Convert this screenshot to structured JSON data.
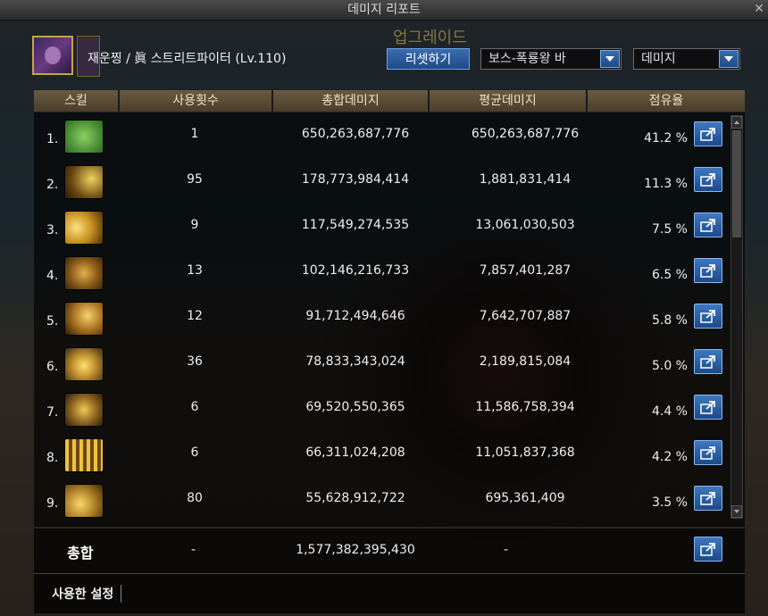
{
  "window": {
    "title": "데미지 리포트",
    "close_glyph": "✕"
  },
  "character": {
    "name": "재운찡 / 眞 스트리트파이터 (Lv.110)"
  },
  "controls": {
    "reset_label": "리셋하기",
    "boss_select_value": "보스-폭룡왕 바",
    "metric_select_value": "데미지"
  },
  "background_text": {
    "upgrade": "업그레이드"
  },
  "table": {
    "headers": [
      "스킬",
      "사용횟수",
      "총합데미지",
      "평균데미지",
      "점유율"
    ],
    "rows": [
      {
        "rank": "1.",
        "icon": "skill-icon-1",
        "uses": "1",
        "total": "650,263,687,776",
        "avg": "650,263,687,776",
        "pct": "41.2 %"
      },
      {
        "rank": "2.",
        "icon": "skill-icon-2",
        "uses": "95",
        "total": "178,773,984,414",
        "avg": "1,881,831,414",
        "pct": "11.3 %"
      },
      {
        "rank": "3.",
        "icon": "skill-icon-3",
        "uses": "9",
        "total": "117,549,274,535",
        "avg": "13,061,030,503",
        "pct": "7.5 %"
      },
      {
        "rank": "4.",
        "icon": "skill-icon-4",
        "uses": "13",
        "total": "102,146,216,733",
        "avg": "7,857,401,287",
        "pct": "6.5 %"
      },
      {
        "rank": "5.",
        "icon": "skill-icon-5",
        "uses": "12",
        "total": "91,712,494,646",
        "avg": "7,642,707,887",
        "pct": "5.8 %"
      },
      {
        "rank": "6.",
        "icon": "skill-icon-6",
        "uses": "36",
        "total": "78,833,343,024",
        "avg": "2,189,815,084",
        "pct": "5.0 %"
      },
      {
        "rank": "7.",
        "icon": "skill-icon-7",
        "uses": "6",
        "total": "69,520,550,365",
        "avg": "11,586,758,394",
        "pct": "4.4 %"
      },
      {
        "rank": "8.",
        "icon": "skill-icon-8",
        "uses": "6",
        "total": "66,311,024,208",
        "avg": "11,051,837,368",
        "pct": "4.2 %"
      },
      {
        "rank": "9.",
        "icon": "skill-icon-9",
        "uses": "80",
        "total": "55,628,912,722",
        "avg": "695,361,409",
        "pct": "3.5 %"
      }
    ]
  },
  "summary": {
    "label": "총합",
    "uses": "-",
    "total": "1,577,382,395,430",
    "avg": "-"
  },
  "settings": {
    "label": "사용한 설정"
  },
  "colors": {
    "header_bg": "#5a4c36",
    "button_blue": "#2a5ca0",
    "skill_gold": "#c8a040",
    "skill_green": "#5aa040"
  }
}
